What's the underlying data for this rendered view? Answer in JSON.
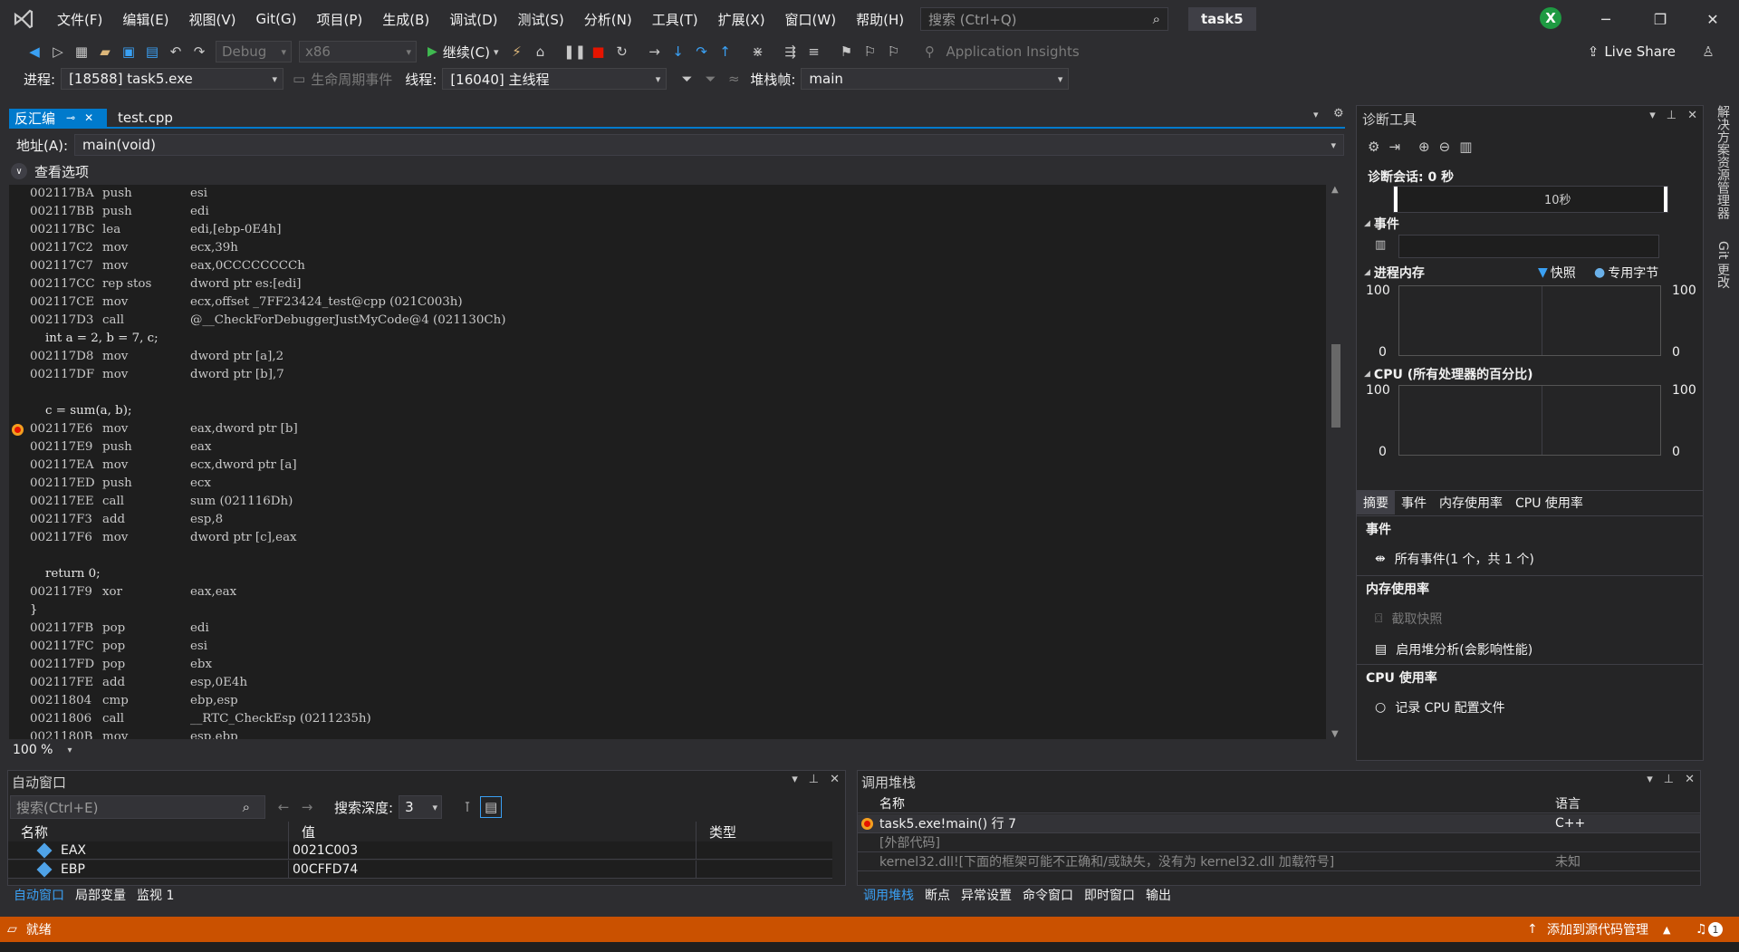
{
  "menu": {
    "items": [
      "文件(F)",
      "编辑(E)",
      "视图(V)",
      "Git(G)",
      "项目(P)",
      "生成(B)",
      "调试(D)",
      "测试(S)",
      "分析(N)",
      "工具(T)",
      "扩展(X)",
      "窗口(W)",
      "帮助(H)"
    ],
    "search_placeholder": "搜索 (Ctrl+Q)",
    "solution_name": "task5",
    "avatar_letter": "X"
  },
  "toolbar": {
    "config": "Debug",
    "platform": "x86",
    "continue_label": "继续(C)",
    "app_insights": "Application Insights",
    "live_share": "Live Share"
  },
  "debug_location": {
    "process_label": "进程:",
    "process_value": "[18588] task5.exe",
    "lifecycle_label": "生命周期事件",
    "thread_label": "线程:",
    "thread_value": "[16040] 主线程",
    "frame_label": "堆栈帧:",
    "frame_value": "main"
  },
  "editor": {
    "tab_disasm": "反汇编",
    "tab_file": "test.cpp",
    "address_label": "地址(A):",
    "address_value": "main(void)",
    "view_options": "查看选项",
    "zoom": "100 %",
    "lines": [
      {
        "addr": "002117BA",
        "mnem": "push",
        "ops": "esi"
      },
      {
        "addr": "002117BB",
        "mnem": "push",
        "ops": "edi"
      },
      {
        "addr": "002117BC",
        "mnem": "lea",
        "ops": "edi,[ebp-0E4h]"
      },
      {
        "addr": "002117C2",
        "mnem": "mov",
        "ops": "ecx,39h"
      },
      {
        "addr": "002117C7",
        "mnem": "mov",
        "ops": "eax,0CCCCCCCCh"
      },
      {
        "addr": "002117CC",
        "mnem": "rep stos",
        "ops": "dword ptr es:[edi]"
      },
      {
        "addr": "002117CE",
        "mnem": "mov",
        "ops": "ecx,offset _7FF23424_test@cpp (021C003h)"
      },
      {
        "addr": "002117D3",
        "mnem": "call",
        "ops": "@__CheckForDebuggerJustMyCode@4 (021130Ch)"
      },
      {
        "src": "    int a = 2, b = 7, c;"
      },
      {
        "addr": "002117D8",
        "mnem": "mov",
        "ops": "dword ptr [a],2"
      },
      {
        "addr": "002117DF",
        "mnem": "mov",
        "ops": "dword ptr [b],7"
      },
      {
        "src": ""
      },
      {
        "src": "    c = sum(a, b);"
      },
      {
        "addr": "002117E6",
        "mnem": "mov",
        "ops": "eax,dword ptr [b]",
        "bp": true
      },
      {
        "addr": "002117E9",
        "mnem": "push",
        "ops": "eax"
      },
      {
        "addr": "002117EA",
        "mnem": "mov",
        "ops": "ecx,dword ptr [a]"
      },
      {
        "addr": "002117ED",
        "mnem": "push",
        "ops": "ecx"
      },
      {
        "addr": "002117EE",
        "mnem": "call",
        "ops": "sum (021116Dh)"
      },
      {
        "addr": "002117F3",
        "mnem": "add",
        "ops": "esp,8"
      },
      {
        "addr": "002117F6",
        "mnem": "mov",
        "ops": "dword ptr [c],eax"
      },
      {
        "src": ""
      },
      {
        "src": "    return 0;"
      },
      {
        "addr": "002117F9",
        "mnem": "xor",
        "ops": "eax,eax"
      },
      {
        "src": "}"
      },
      {
        "addr": "002117FB",
        "mnem": "pop",
        "ops": "edi"
      },
      {
        "addr": "002117FC",
        "mnem": "pop",
        "ops": "esi"
      },
      {
        "addr": "002117FD",
        "mnem": "pop",
        "ops": "ebx"
      },
      {
        "addr": "002117FE",
        "mnem": "add",
        "ops": "esp,0E4h"
      },
      {
        "addr": "00211804",
        "mnem": "cmp",
        "ops": "ebp,esp"
      },
      {
        "addr": "00211806",
        "mnem": "call",
        "ops": "__RTC_CheckEsp (0211235h)"
      },
      {
        "addr": "0021180B",
        "mnem": "mov",
        "ops": "esp,ebp"
      }
    ]
  },
  "diagnostics": {
    "title": "诊断工具",
    "session": "诊断会话: 0 秒",
    "timeline_label": "10秒",
    "events_header": "事件",
    "memory_header": "进程内存",
    "legend_snapshot": "快照",
    "legend_bytes": "专用字节",
    "cpu_header": "CPU (所有处理器的百分比)",
    "axis_max": "100",
    "axis_min": "0",
    "tabs": [
      "摘要",
      "事件",
      "内存使用率",
      "CPU 使用率"
    ],
    "summary": {
      "events_h": "事件",
      "all_events": "所有事件(1 个，共 1 个)",
      "memory_h": "内存使用率",
      "take_snapshot": "截取快照",
      "heap_analysis": "启用堆分析(会影响性能)",
      "cpu_h": "CPU 使用率",
      "record_cpu": "记录 CPU 配置文件"
    }
  },
  "rail": {
    "solution_explorer": "解决方案资源管理器",
    "git_changes": "Git 更改"
  },
  "autos": {
    "title": "自动窗口",
    "search_placeholder": "搜索(Ctrl+E)",
    "depth_label": "搜索深度:",
    "depth_value": "3",
    "col_name": "名称",
    "col_value": "值",
    "col_type": "类型",
    "rows": [
      {
        "name": "EAX",
        "value": "0021C003"
      },
      {
        "name": "EBP",
        "value": "00CFFD74"
      }
    ],
    "tabs": [
      "自动窗口",
      "局部变量",
      "监视 1"
    ]
  },
  "callstack": {
    "title": "调用堆栈",
    "col_name": "名称",
    "col_lang": "语言",
    "rows": [
      {
        "name": "task5.exe!main() 行 7",
        "lang": "C++"
      },
      {
        "name": "[外部代码]",
        "lang": ""
      },
      {
        "name": "kernel32.dll![下面的框架可能不正确和/或缺失，没有为 kernel32.dll 加载符号]",
        "lang": "未知"
      }
    ],
    "tabs": [
      "调用堆栈",
      "断点",
      "异常设置",
      "命令窗口",
      "即时窗口",
      "输出"
    ]
  },
  "status": {
    "ready": "就绪",
    "source_control": "添加到源代码管理",
    "notification_count": "1"
  }
}
